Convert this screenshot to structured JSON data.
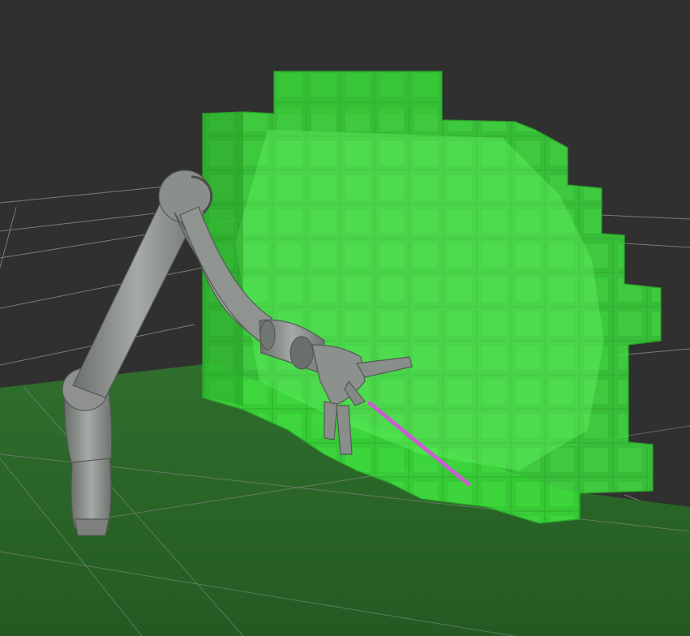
{
  "scene": {
    "background_color": "#303030",
    "floor_color": "#2d6a2a",
    "grid_line_color": "#8f8f8f",
    "voxel_color": "#3dff3d",
    "arm_color": "#8e918e",
    "marker_color": "#c85fd0"
  }
}
